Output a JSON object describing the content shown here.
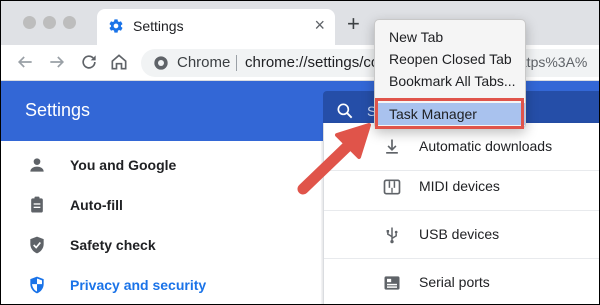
{
  "tab": {
    "title": "Settings",
    "close": "×"
  },
  "newtab_glyph": "+",
  "omnibox": {
    "chrome_label": "Chrome",
    "url": "chrome://settings/co",
    "url_tail": "https%3A%"
  },
  "header": {
    "title": "Settings",
    "search_placeholder": "S"
  },
  "sidebar": {
    "items": [
      {
        "label": "You and Google",
        "icon": "person-icon"
      },
      {
        "label": "Auto-fill",
        "icon": "clipboard-icon"
      },
      {
        "label": "Safety check",
        "icon": "shield-check-icon"
      },
      {
        "label": "Privacy and security",
        "icon": "shield-icon",
        "active": true
      }
    ]
  },
  "content": {
    "rows": [
      {
        "label": "Automatic downloads",
        "icon": "download-icon"
      },
      {
        "label": "MIDI devices",
        "icon": "piano-icon"
      },
      {
        "label": "USB devices",
        "icon": "usb-icon"
      },
      {
        "label": "Serial ports",
        "icon": "serial-port-icon"
      }
    ]
  },
  "menu": {
    "items": [
      {
        "label": "New Tab"
      },
      {
        "label": "Reopen Closed Tab"
      },
      {
        "label": "Bookmark All Tabs..."
      },
      {
        "label": "Task Manager",
        "highlighted": true
      }
    ]
  },
  "colors": {
    "accent": "#3367d6",
    "highlight_border": "#e0544a",
    "arrow": "#e0544a"
  }
}
